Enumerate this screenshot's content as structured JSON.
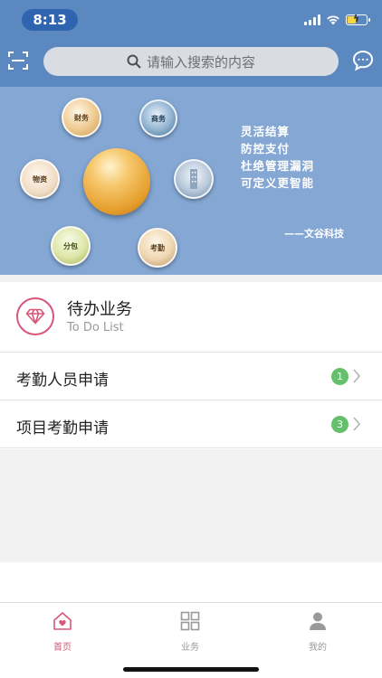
{
  "status_bar": {
    "time": "8:13"
  },
  "header": {
    "search_placeholder": "请输入搜索的内容",
    "scan_icon": "scan-icon",
    "message_icon": "chat-bubble-icon",
    "bg_color": "#5b88bf"
  },
  "banner": {
    "bubbles": [
      "财务",
      "商务",
      "物资",
      "分包",
      "考勤"
    ],
    "slogans": [
      "灵活结算",
      "防控支付",
      "杜绝管理漏洞",
      "可定义更智能"
    ],
    "signature": "——文谷科技",
    "bg_color": "#84a7d4"
  },
  "todo": {
    "title": "待办业务",
    "subtitle": "To Do List",
    "icon": "diamond-icon",
    "items": [
      {
        "label": "考勤人员申请",
        "count": "1"
      },
      {
        "label": "项目考勤申请",
        "count": "3"
      }
    ],
    "badge_color": "#65c06d"
  },
  "tabbar": {
    "tabs": [
      {
        "label": "首页",
        "icon": "home-icon",
        "active": true
      },
      {
        "label": "业务",
        "icon": "grid-icon",
        "active": false
      },
      {
        "label": "我的",
        "icon": "person-icon",
        "active": false
      }
    ],
    "active_color": "#d7577a",
    "inactive_color": "#9a9a9a"
  }
}
